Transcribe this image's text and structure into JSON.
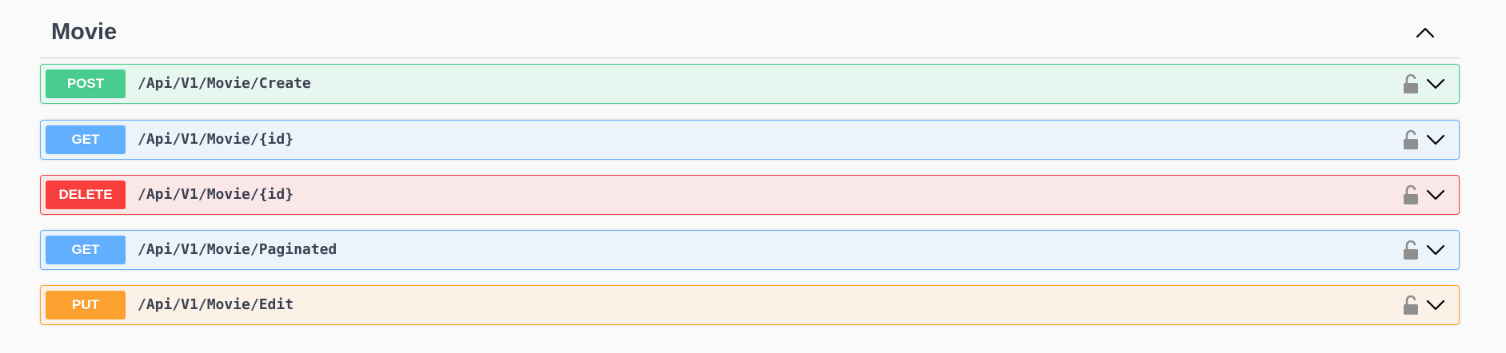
{
  "tag": {
    "title": "Movie"
  },
  "colors": {
    "post": "#49cc90",
    "get": "#61affe",
    "delete": "#f93e3e",
    "put": "#fca130",
    "text": "#3b4151",
    "lock": "#8f8f8f"
  },
  "icons": {
    "collapse": "chevron-up-icon",
    "expand": "chevron-down-icon",
    "lock": "unlocked-padlock-icon"
  },
  "operations": [
    {
      "method": "POST",
      "path": "/Api/V1/Movie/Create"
    },
    {
      "method": "GET",
      "path": "/Api/V1/Movie/{id}"
    },
    {
      "method": "DELETE",
      "path": "/Api/V1/Movie/{id}"
    },
    {
      "method": "GET",
      "path": "/Api/V1/Movie/Paginated"
    },
    {
      "method": "PUT",
      "path": "/Api/V1/Movie/Edit"
    }
  ]
}
